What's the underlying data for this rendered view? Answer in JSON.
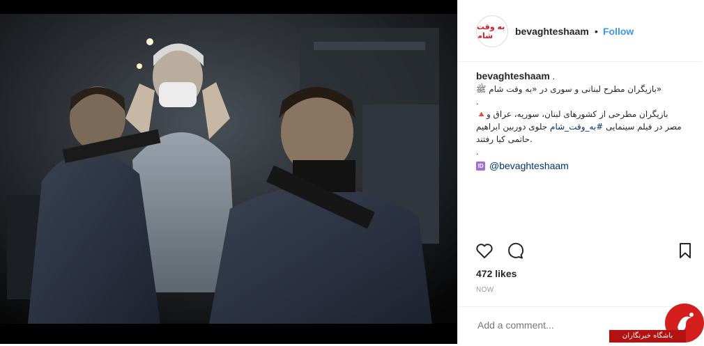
{
  "post": {
    "username": "bevaghteshaam",
    "dot": "•",
    "follow_label": "Follow",
    "avatar_text": "به وقت شام",
    "caption": {
      "username": "bevaghteshaam",
      "username_suffix": " .",
      "line1": "«بازیگران مطرح لبنانی و سوری در «به وقت شام ﷺ",
      "line2": ".",
      "line3": "بازیگران مطرحی از کشورهای لبنان، سوریه، عراق و🔺",
      "line4_prefix": "مصر در فیلم سینمایی ",
      "line4_hashtag": "#به_وقت_شام",
      "line4_suffix": " جلوی دوربین ابراهیم",
      "line5": ".حاتمی کیا رفتند",
      "line6": ".",
      "id_badge": "ID",
      "mention": "@bevaghteshaam"
    },
    "likes": "472 likes",
    "time": "NOW",
    "comment_placeholder": "Add a comment..."
  },
  "icons": {
    "like": "heart-icon",
    "comment": "comment-icon",
    "save": "bookmark-icon"
  },
  "watermark": {
    "text": "باشگاه خبرنگاران"
  }
}
